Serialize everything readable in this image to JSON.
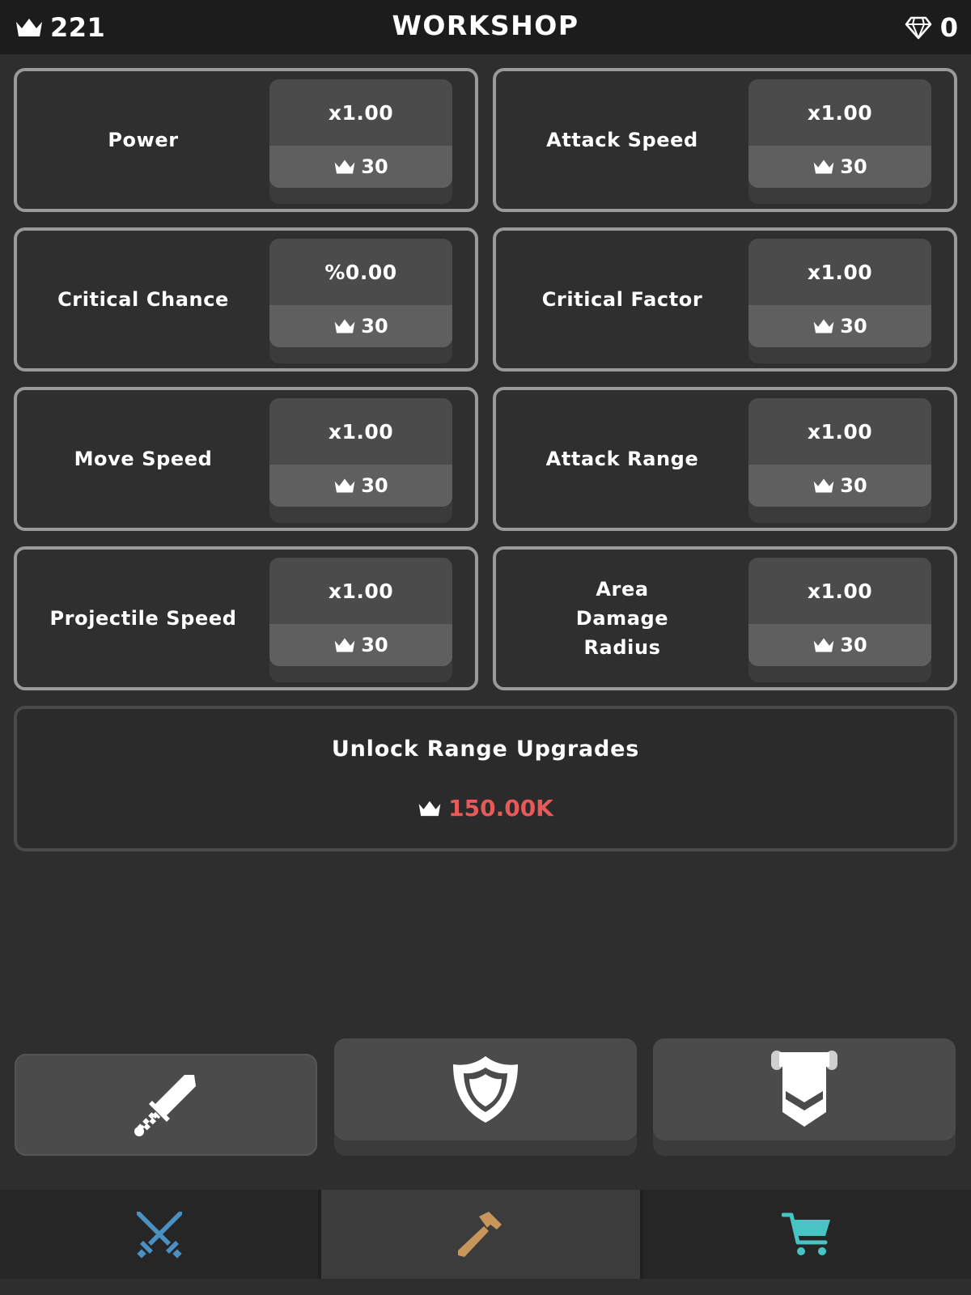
{
  "header": {
    "title": "WORKSHOP",
    "crowns": "221",
    "gems": "0"
  },
  "upgrades": [
    {
      "name": "Power",
      "value": "x1.00",
      "cost": "30"
    },
    {
      "name": "Attack Speed",
      "value": "x1.00",
      "cost": "30"
    },
    {
      "name": "Critical Chance",
      "value": "%0.00",
      "cost": "30"
    },
    {
      "name": "Critical Factor",
      "value": "x1.00",
      "cost": "30"
    },
    {
      "name": "Move Speed",
      "value": "x1.00",
      "cost": "30"
    },
    {
      "name": "Attack Range",
      "value": "x1.00",
      "cost": "30"
    },
    {
      "name": "Projectile Speed",
      "value": "x1.00",
      "cost": "30"
    },
    {
      "name": "Area Damage Radius",
      "value": "x1.00",
      "cost": "30"
    }
  ],
  "unlock": {
    "title": "Unlock Range Upgrades",
    "price": "150.00K"
  },
  "categories": [
    {
      "id": "attack",
      "icon": "sword-icon"
    },
    {
      "id": "defense",
      "icon": "shield-icon"
    },
    {
      "id": "utility",
      "icon": "banner-icon"
    }
  ],
  "nav": [
    {
      "id": "battle",
      "icon": "crossed-swords-icon",
      "color": "#4a90c2"
    },
    {
      "id": "workshop",
      "icon": "hammer-icon",
      "color": "#c8955a",
      "active": true
    },
    {
      "id": "shop",
      "icon": "cart-icon",
      "color": "#48c4c4"
    }
  ],
  "colors": {
    "price_insufficient": "#e85a5a",
    "background": "#2e2e2e",
    "header": "#1c1c1c"
  }
}
